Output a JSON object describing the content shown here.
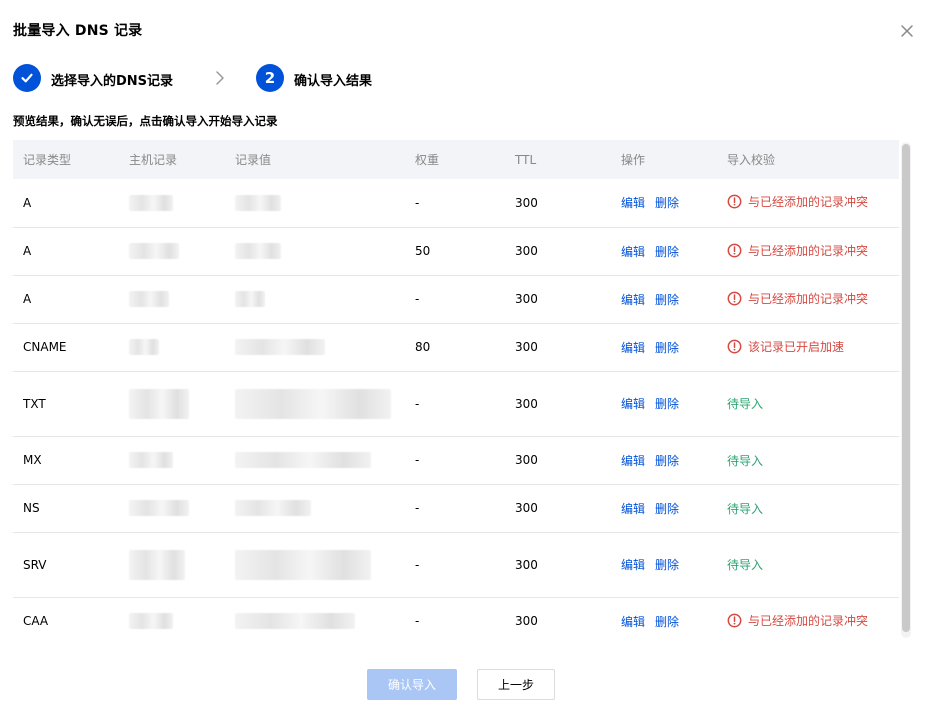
{
  "dialog": {
    "title": "批量导入 DNS 记录",
    "close_icon": "close-icon"
  },
  "steps": {
    "step1": {
      "label": "选择导入的DNS记录",
      "state": "done",
      "icon": "check-icon"
    },
    "separator_icon": "chevron-right-icon",
    "step2": {
      "label": "确认导入结果",
      "number": "2",
      "state": "active"
    }
  },
  "hint": "预览结果，确认无误后，点击确认导入开始导入记录",
  "table": {
    "headers": [
      "记录类型",
      "主机记录",
      "记录值",
      "权重",
      "TTL",
      "操作",
      "导入校验"
    ],
    "edit_label": "编辑",
    "delete_label": "删除",
    "rows": [
      {
        "type": "A",
        "weight": "-",
        "ttl": "300",
        "status": "与已经添加的记录冲突",
        "status_kind": "error"
      },
      {
        "type": "A",
        "weight": "50",
        "ttl": "300",
        "status": "与已经添加的记录冲突",
        "status_kind": "error"
      },
      {
        "type": "A",
        "weight": "-",
        "ttl": "300",
        "status": "与已经添加的记录冲突",
        "status_kind": "error"
      },
      {
        "type": "CNAME",
        "weight": "80",
        "ttl": "300",
        "status": "该记录已开启加速",
        "status_kind": "error"
      },
      {
        "type": "TXT",
        "weight": "-",
        "ttl": "300",
        "status": "待导入",
        "status_kind": "ok"
      },
      {
        "type": "MX",
        "weight": "-",
        "ttl": "300",
        "status": "待导入",
        "status_kind": "ok"
      },
      {
        "type": "NS",
        "weight": "-",
        "ttl": "300",
        "status": "待导入",
        "status_kind": "ok"
      },
      {
        "type": "SRV",
        "weight": "-",
        "ttl": "300",
        "status": "待导入",
        "status_kind": "ok"
      },
      {
        "type": "CAA",
        "weight": "-",
        "ttl": "300",
        "status": "与已经添加的记录冲突",
        "status_kind": "error"
      }
    ]
  },
  "footer": {
    "confirm_label": "确认导入",
    "back_label": "上一步"
  },
  "colors": {
    "brand": "#0052d9",
    "error": "#d54941",
    "success": "#2ba471",
    "primary_disabled": "#a9c6f5",
    "header_bg": "#f3f4f7"
  }
}
